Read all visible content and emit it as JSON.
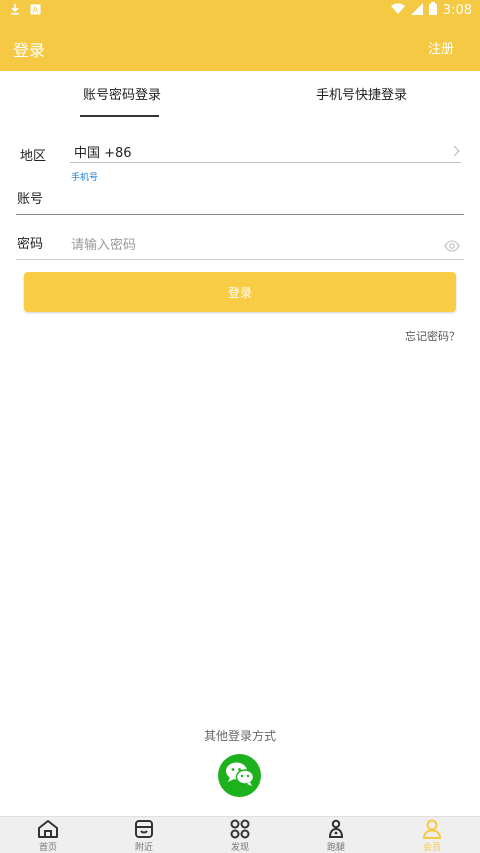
{
  "status": {
    "time": "3:08"
  },
  "header": {
    "title": "登录",
    "action": "注册"
  },
  "tabs": [
    {
      "label": "账号密码登录",
      "active": true
    },
    {
      "label": "手机号快捷登录",
      "active": false
    }
  ],
  "form": {
    "region_label": "地区",
    "region_value": "中国 +86",
    "account_hint_small": "手机号",
    "account_label": "账号",
    "password_label": "密码",
    "password_placeholder": "请输入密码"
  },
  "login_button": "登录",
  "forgot_link": "忘记密码？",
  "other_login": "其他登录方式",
  "bottom_nav": [
    {
      "label": "首页",
      "icon": "home-icon",
      "active": false
    },
    {
      "label": "附近",
      "icon": "store-icon",
      "active": false
    },
    {
      "label": "发现",
      "icon": "discover-icon",
      "active": false
    },
    {
      "label": "跑腿",
      "icon": "errand-icon",
      "active": false
    },
    {
      "label": "会员",
      "icon": "user-icon",
      "active": true
    }
  ],
  "colors": {
    "accent": "#f6c944",
    "wechat": "#1db21d"
  }
}
